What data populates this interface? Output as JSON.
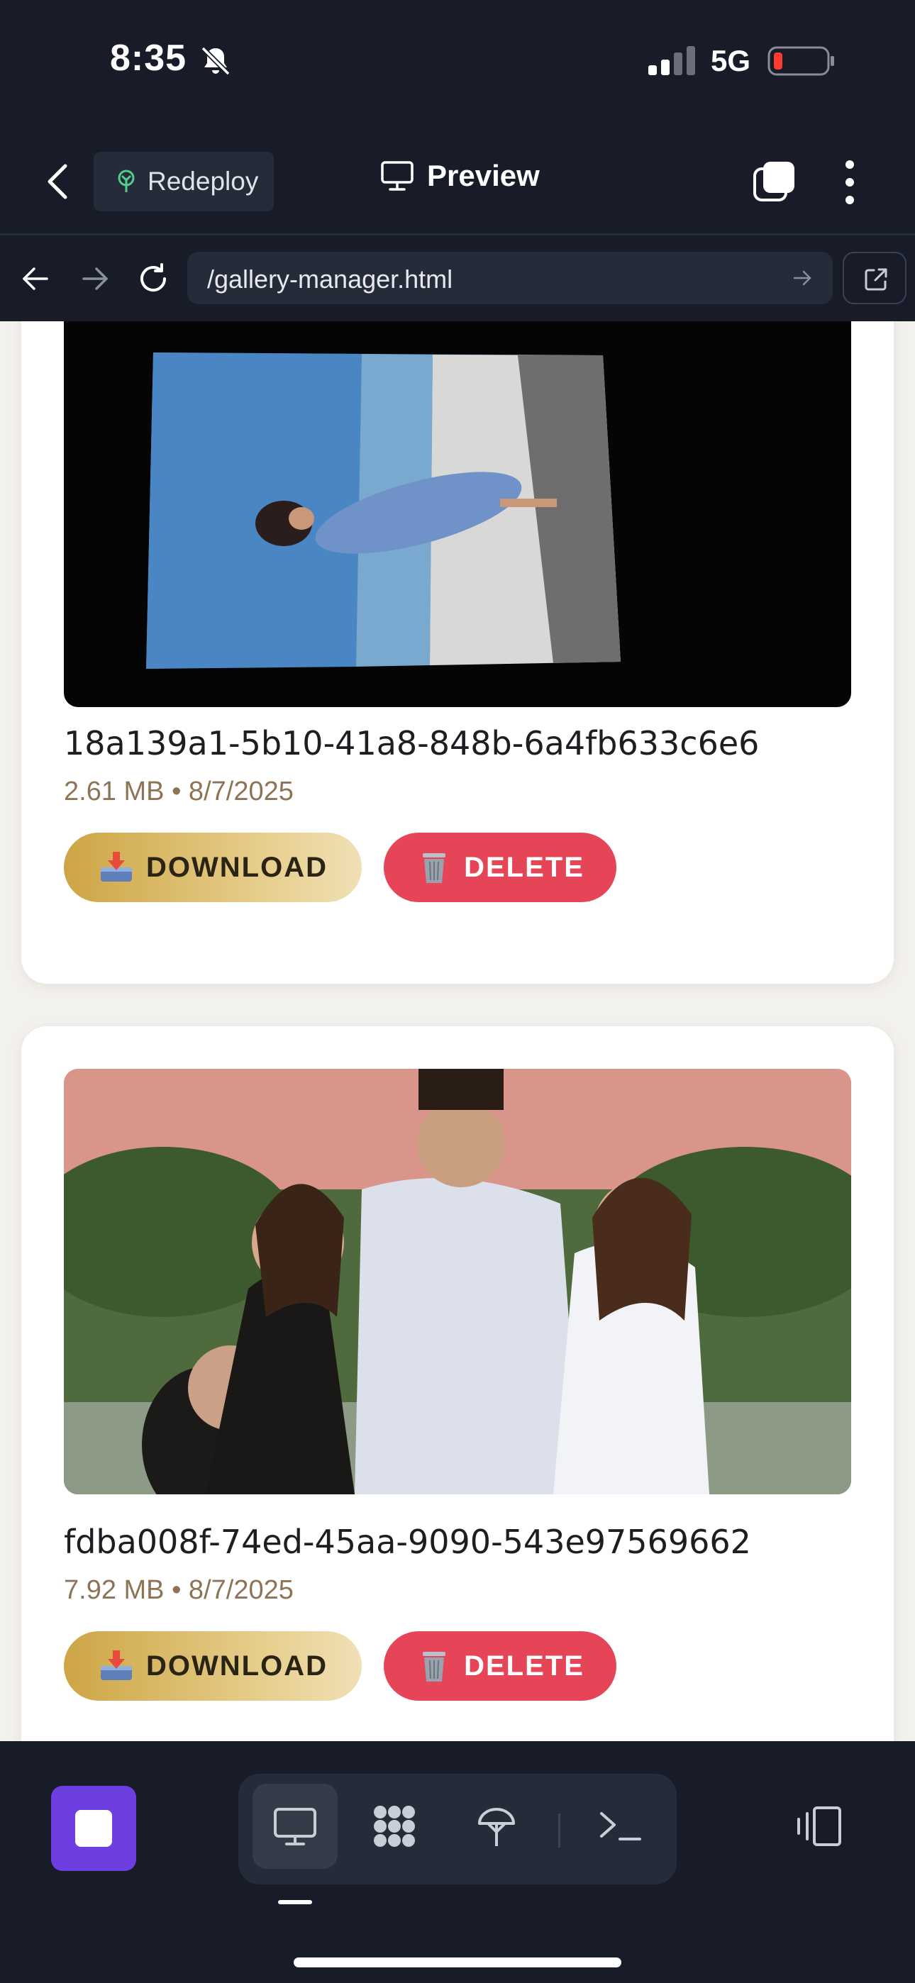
{
  "status_bar": {
    "time": "8:35",
    "network": "5G"
  },
  "header": {
    "redeploy_label": "Redeploy",
    "title": "Preview"
  },
  "browser": {
    "url": "/gallery-manager.html"
  },
  "gallery": {
    "items": [
      {
        "name": "18a139a1-5b10-41a8-848b-6a4fb633c6e6",
        "meta": "2.61 MB • 8/7/2025",
        "download_label": "DOWNLOAD",
        "delete_label": "DELETE"
      },
      {
        "name": "fdba008f-74ed-45aa-9090-543e97569662",
        "meta": "7.92 MB • 8/7/2025",
        "download_label": "DOWNLOAD",
        "delete_label": "DELETE"
      }
    ]
  },
  "bottom_tools": [
    "desktop-icon",
    "grid-icon",
    "deploy-icon",
    "terminal-icon"
  ],
  "colors": {
    "background": "#181c28",
    "accent": "#6d3fe0",
    "download_gold": "#cda545",
    "delete_red": "#e64558",
    "meta_text": "#8e7456"
  }
}
